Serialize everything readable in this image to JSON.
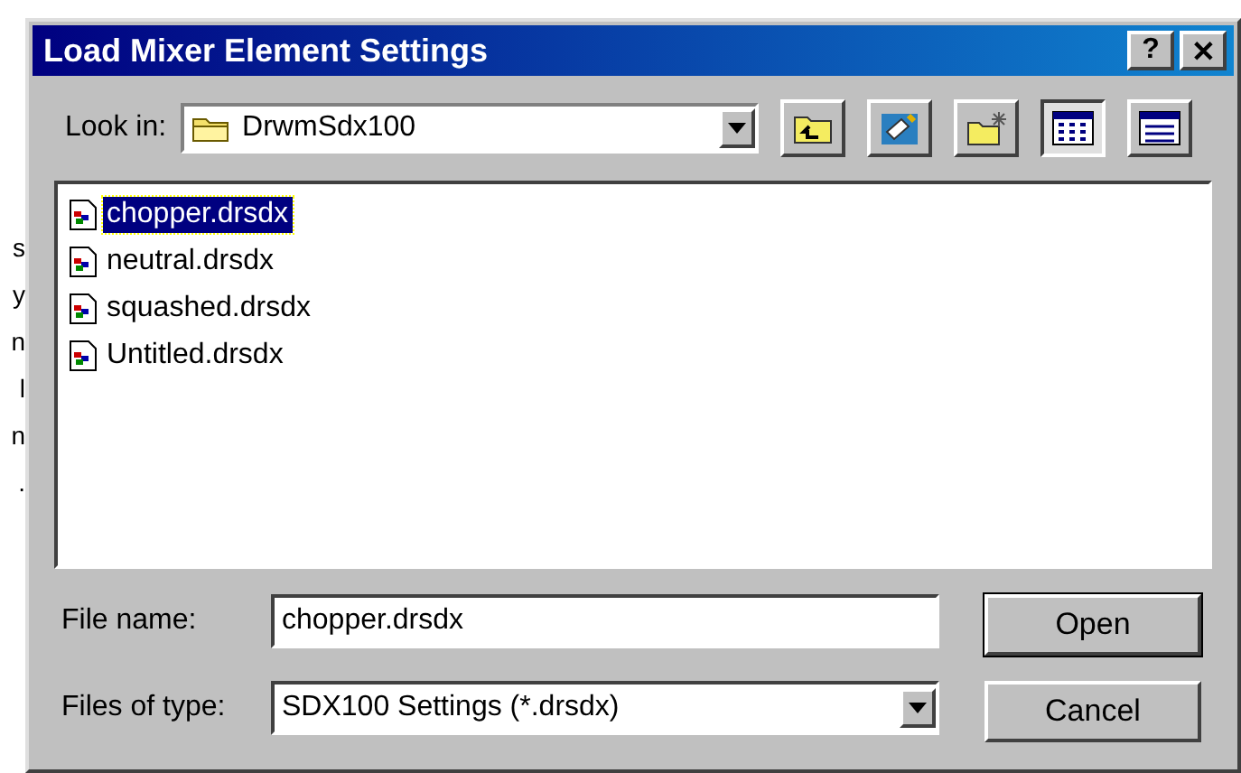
{
  "background_text": [
    "s",
    "y",
    "n",
    "l",
    "n",
    "."
  ],
  "window": {
    "title": "Load Mixer Element Settings",
    "title_buttons": [
      "?",
      "✕"
    ]
  },
  "look_in": {
    "label": "Look in:",
    "value": "DrwmSdx100"
  },
  "toolbar": [
    {
      "kind": "up",
      "selected": false
    },
    {
      "kind": "desktop",
      "selected": false
    },
    {
      "kind": "newfolder",
      "selected": false
    },
    {
      "kind": "list",
      "selected": true
    },
    {
      "kind": "details",
      "selected": false
    }
  ],
  "files": [
    {
      "name": "chopper.drsdx",
      "selected": true
    },
    {
      "name": "neutral.drsdx",
      "selected": false
    },
    {
      "name": "squashed.drsdx",
      "selected": false
    },
    {
      "name": "Untitled.drsdx",
      "selected": false
    }
  ],
  "file_name": {
    "label": "File name:",
    "value": "chopper.drsdx"
  },
  "file_type": {
    "label": "Files of type:",
    "value": "SDX100 Settings (*.drsdx)"
  },
  "buttons": [
    "Open",
    "Cancel"
  ]
}
